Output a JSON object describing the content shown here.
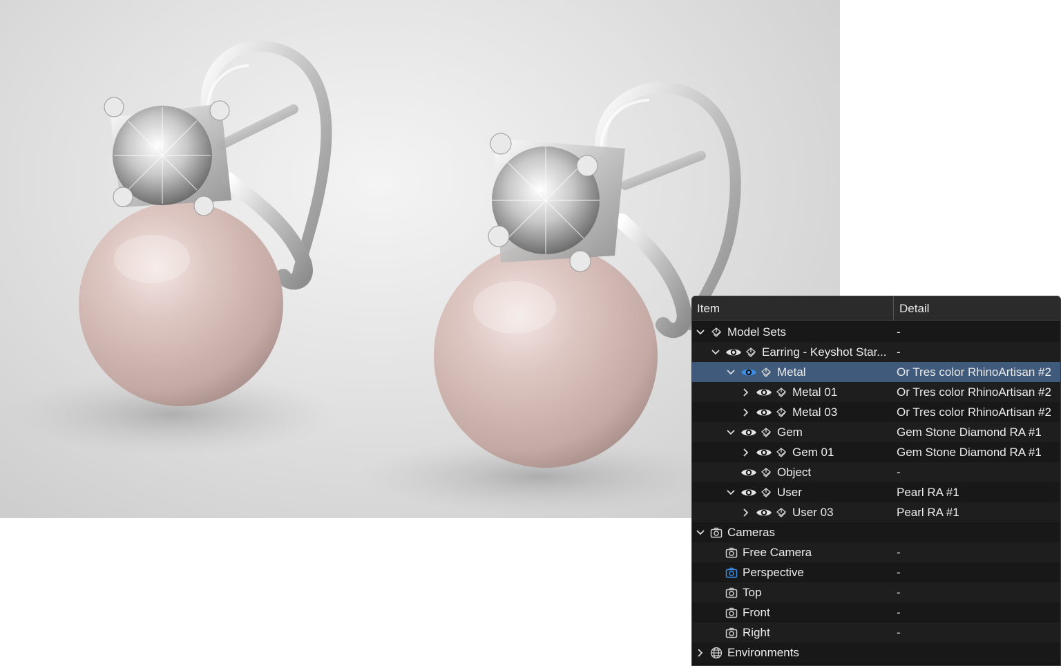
{
  "panel": {
    "headers": {
      "item": "Item",
      "detail": "Detail"
    },
    "rows": [
      {
        "label": "Model Sets",
        "detail": "-",
        "depth": 0,
        "chevron": "down",
        "eye": false,
        "icon": "object-icon"
      },
      {
        "label": "Earring - Keyshot Star...",
        "detail": "-",
        "depth": 1,
        "chevron": "down",
        "eye": true,
        "icon": "object-icon"
      },
      {
        "label": "Metal",
        "detail": "Or Tres color RhinoArtisan #2",
        "depth": 2,
        "chevron": "down",
        "eye": true,
        "eye_active": true,
        "icon": "object-icon",
        "selected": true
      },
      {
        "label": "Metal 01",
        "detail": "Or Tres color RhinoArtisan #2",
        "depth": 3,
        "chevron": "right",
        "eye": true,
        "icon": "object-icon"
      },
      {
        "label": "Metal 03",
        "detail": "Or Tres color RhinoArtisan #2",
        "depth": 3,
        "chevron": "right",
        "eye": true,
        "icon": "object-icon"
      },
      {
        "label": "Gem",
        "detail": "Gem Stone Diamond RA #1",
        "depth": 2,
        "chevron": "down",
        "eye": true,
        "icon": "object-icon"
      },
      {
        "label": "Gem 01",
        "detail": "Gem Stone Diamond RA #1",
        "depth": 3,
        "chevron": "right",
        "eye": true,
        "icon": "object-icon"
      },
      {
        "label": "Object",
        "detail": "-",
        "depth": 2,
        "chevron": "",
        "eye": true,
        "icon": "object-icon"
      },
      {
        "label": "User",
        "detail": "Pearl RA #1",
        "depth": 2,
        "chevron": "down",
        "eye": true,
        "icon": "object-icon"
      },
      {
        "label": "User 03",
        "detail": "Pearl RA #1",
        "depth": 3,
        "chevron": "right",
        "eye": true,
        "icon": "object-icon"
      },
      {
        "label": "Cameras",
        "detail": "",
        "depth": 0,
        "chevron": "down",
        "eye": false,
        "icon": "camera-icon"
      },
      {
        "label": "Free Camera",
        "detail": "-",
        "depth": 1,
        "chevron": "",
        "eye": false,
        "icon": "camera-icon"
      },
      {
        "label": "Perspective",
        "detail": "-",
        "depth": 1,
        "chevron": "",
        "eye": false,
        "icon": "camera-icon",
        "icon_active": true
      },
      {
        "label": "Top",
        "detail": "-",
        "depth": 1,
        "chevron": "",
        "eye": false,
        "icon": "camera-icon"
      },
      {
        "label": "Front",
        "detail": "-",
        "depth": 1,
        "chevron": "",
        "eye": false,
        "icon": "camera-icon"
      },
      {
        "label": "Right",
        "detail": "-",
        "depth": 1,
        "chevron": "",
        "eye": false,
        "icon": "camera-icon"
      },
      {
        "label": "Environments",
        "detail": "",
        "depth": 0,
        "chevron": "right",
        "eye": false,
        "icon": "globe-icon"
      }
    ]
  },
  "colors": {
    "panel_bg": "#151515",
    "selected_row": "#3f5a7a",
    "active_icon": "#3d8ee6",
    "text": "#ededed"
  }
}
